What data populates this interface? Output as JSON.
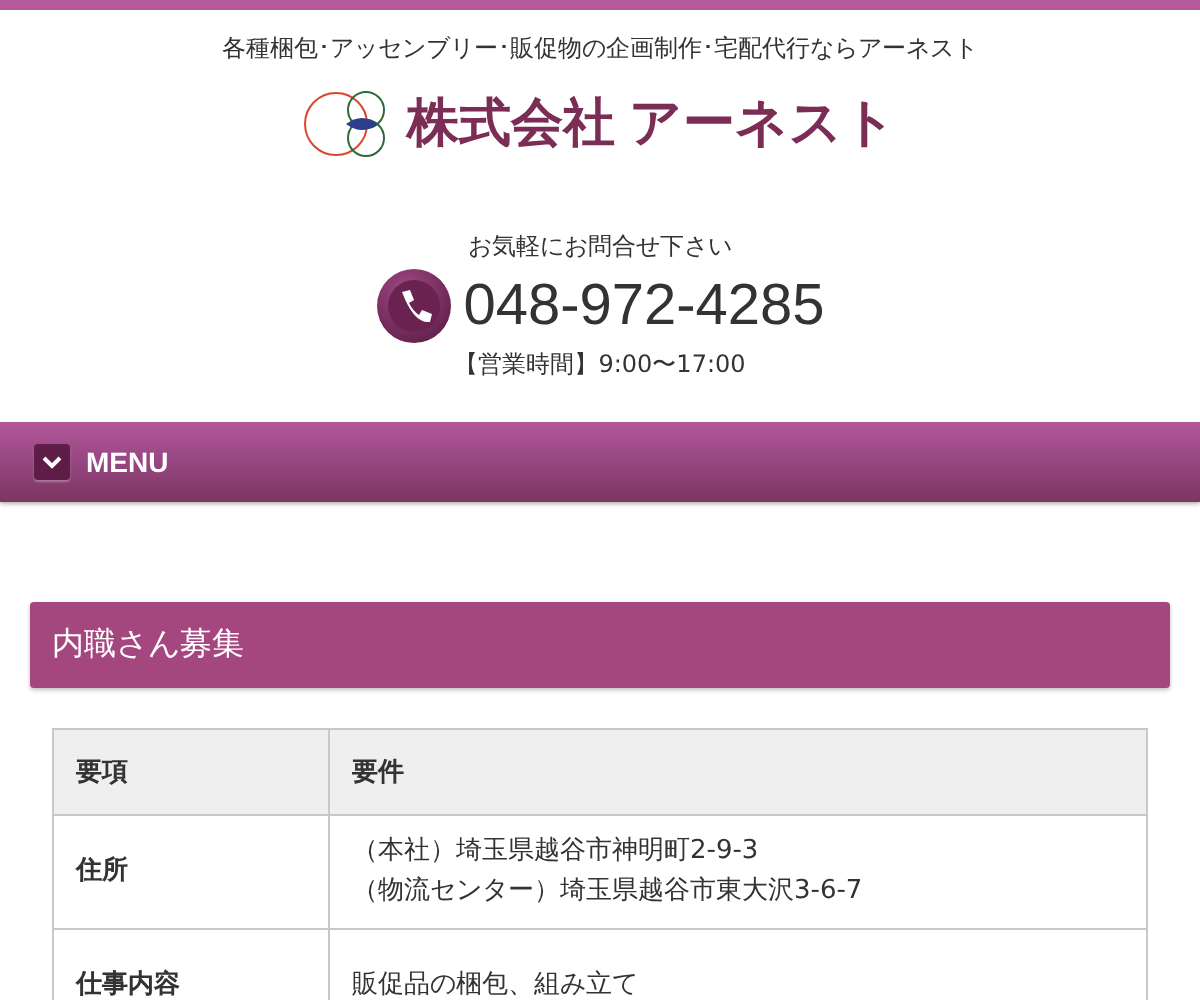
{
  "header": {
    "tagline": "各種梱包･アッセンブリー･販促物の企画制作･宅配代行ならアーネスト",
    "company": "株式会社 アーネスト"
  },
  "contact": {
    "prompt": "お気軽にお問合せ下さい",
    "phone": "048-972-4285",
    "hours": "【営業時間】9:00〜17:00"
  },
  "menu": {
    "label": "MENU",
    "expanded": false
  },
  "section": {
    "title": "内職さん募集"
  },
  "table": {
    "columns": [
      "要項",
      "要件"
    ],
    "rows": [
      {
        "label": "住所",
        "lines": [
          "（本社）埼玉県越谷市神明町2-9-3",
          "（物流センター）埼玉県越谷市東大沢3-6-7"
        ]
      },
      {
        "label": "仕事内容",
        "lines": [
          "販促品の梱包、組み立て"
        ]
      }
    ]
  }
}
